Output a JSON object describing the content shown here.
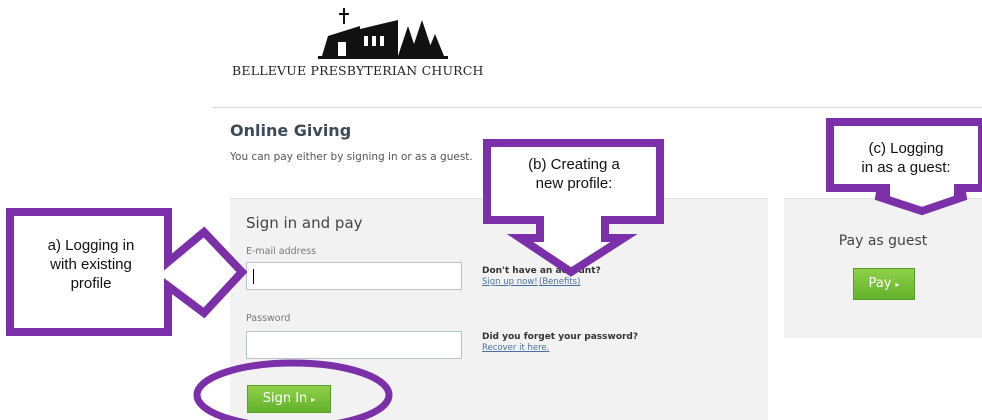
{
  "logo": {
    "org_name": "BELLEVUE PRESBYTERIAN CHURCH",
    "icon": "church-silhouette-icon"
  },
  "page": {
    "title": "Online Giving",
    "intro": "You can pay either by signing in or as a guest."
  },
  "signin": {
    "title": "Sign in and pay",
    "email_label": "E-mail address",
    "email_value": "",
    "password_label": "Password",
    "password_value": "",
    "no_account_title": "Don't have an account?",
    "signup_link": "Sign up now!",
    "benefits_link": "(Benefits)",
    "forgot_title": "Did you forget your password?",
    "recover_link": "Recover it here.",
    "button_label": "Sign In"
  },
  "guest": {
    "title": "Pay as guest",
    "button_label": "Pay"
  },
  "annotations": {
    "a_line1": "a) Logging in",
    "a_line2": "with existing",
    "a_line3": "profile",
    "b_line1": "(b) Creating a",
    "b_line2": "new profile:",
    "c_line1": "(c) Logging",
    "c_line2": "in as a guest:",
    "color": "#7b2fa8"
  },
  "colors": {
    "button_green": "#6dbb35",
    "panel_bg": "#f2f2f2",
    "link": "#4a6fa0"
  }
}
